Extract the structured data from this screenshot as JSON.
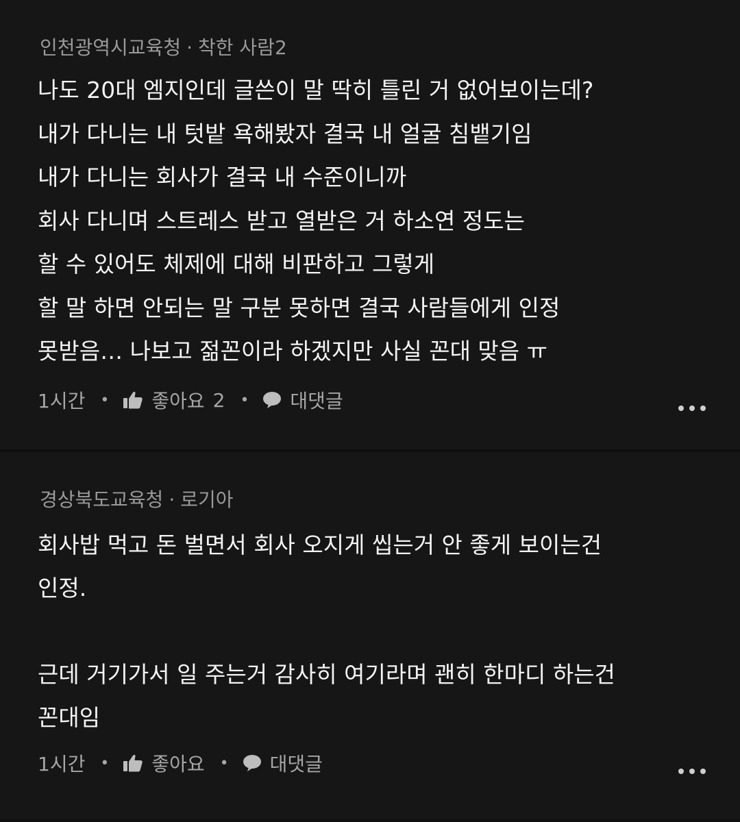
{
  "comments": [
    {
      "school": "인천광역시교육청",
      "separator": "·",
      "author": "착한 사람2",
      "lines": [
        "나도 20대 엠지인데 글쓴이 말 딱히 틀린 거 없어보이는데?",
        "내가 다니는 내 텃밭 욕해봤자 결국 내 얼굴 침뱉기임",
        "내가 다니는 회사가 결국 내 수준이니까",
        "회사 다니며 스트레스 받고 열받은 거 하소연 정도는",
        "할 수 있어도 체제에 대해 비판하고 그렇게",
        "할 말 하면 안되는 말 구분 못하면 결국 사람들에게 인정",
        "못받음… 나보고 젊꼰이라 하겠지만 사실 꼰대 맞음 ㅠ"
      ],
      "time": "1시간",
      "like_label": "좋아요",
      "like_count": "2",
      "reply_label": "대댓글"
    },
    {
      "school": "경상북도교육청",
      "separator": "·",
      "author": "로기아",
      "paragraph1": [
        "회사밥 먹고 돈 벌면서 회사 오지게 씹는거 안 좋게 보이는건",
        "인정."
      ],
      "paragraph2": [
        "근데 거기가서 일 주는거 감사히 여기라며 괜히 한마디 하는건",
        "꼰대임"
      ],
      "time": "1시간",
      "like_label": "좋아요",
      "reply_label": "대댓글"
    }
  ],
  "icons": {
    "like": "thumbs-up-icon",
    "reply": "speech-bubble-icon",
    "more": "more-options-icon"
  },
  "colors": {
    "background": "#161616",
    "meta_text": "#9a9a9a",
    "body_text": "#f4f4f4"
  }
}
